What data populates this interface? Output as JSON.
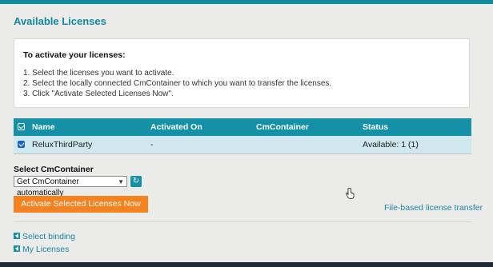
{
  "page": {
    "title": "Available Licenses"
  },
  "instructions": {
    "heading": "To activate your licenses:",
    "steps": [
      "1. Select the licenses you want to activate.",
      "2. Select the locally connected CmContainer to which you want to transfer the licenses.",
      "3. Click \"Activate Selected Licenses Now\"."
    ]
  },
  "table": {
    "headers": {
      "name": "Name",
      "activated_on": "Activated On",
      "cm_container": "CmContainer",
      "status": "Status"
    },
    "rows": [
      {
        "checked": true,
        "name": "ReluxThirdParty",
        "activated_on": "-",
        "cm_container": "",
        "status": "Available: 1 (1)"
      }
    ]
  },
  "select_cm": {
    "label": "Select CmContainer",
    "selected_value": "Get CmContainer automatically",
    "dropdown_icon": "chevron-down-icon",
    "refresh_icon": "refresh-icon"
  },
  "actions": {
    "activate_label": "Activate Selected Licenses Now",
    "file_transfer_label": "File-based license transfer"
  },
  "nav": {
    "select_binding": "Select binding",
    "my_licenses": "My Licenses"
  },
  "colors": {
    "accent": "#0f8a9e",
    "header_bg": "#1491a6",
    "row_selected": "#cfe7ee",
    "button_orange": "#f58220",
    "link": "#1a87a0"
  }
}
